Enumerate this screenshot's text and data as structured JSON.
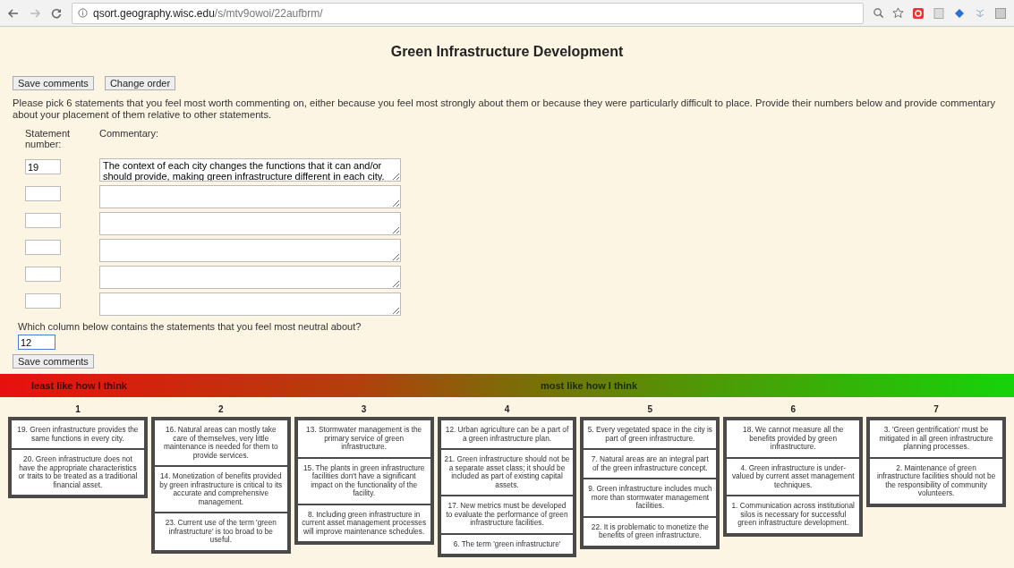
{
  "browser": {
    "url_host": "qsort.geography.wisc.edu",
    "url_path": "/s/mtv9owoi/22aufbrm/"
  },
  "title": "Green Infrastructure Development",
  "top_buttons": [
    "Save comments",
    "Change order"
  ],
  "instructions": "Please pick 6 statements that you feel most worth commenting on, either because you feel most strongly about them or because they were particularly difficult to place. Provide their numbers below and provide commentary about your placement of them relative to other statements.",
  "comments_table": {
    "number_header": "Statement number:",
    "commentary_header": "Commentary:",
    "rows": [
      {
        "number": "19",
        "commentary": "The context of each city changes the functions that it can and/or should provide, making green infrastructure different in each city."
      },
      {},
      {},
      {},
      {},
      {}
    ]
  },
  "neutral_question": {
    "label": "Which column below contains the statements that you feel most neutral about?",
    "value": "12"
  },
  "save_button": "Save comments",
  "scale_bar": {
    "least_label": "least like how I think",
    "most_label": "most like how I think"
  },
  "columns": [
    {
      "label": "1",
      "cards": [
        "19. Green infrastructure provides the same functions in every city.",
        "20. Green infrastructure does not have the appropriate characteristics or traits to be treated as a traditional financial asset."
      ]
    },
    {
      "label": "2",
      "cards": [
        "16. Natural areas can mostly take care of themselves, very little maintenance is needed for them to provide services.",
        "14. Monetization of benefits provided by green infrastructure is critical to its accurate and comprehensive management.",
        "23. Current use of the term 'green infrastructure' is too broad to be useful."
      ]
    },
    {
      "label": "3",
      "cards": [
        "13. Stormwater management is the primary service of green infrastructure.",
        "15. The plants in green infrastructure facilities don't have a significant impact on the functionality of the facility.",
        "8. Including green infrastructure in current asset management processes will improve maintenance schedules."
      ]
    },
    {
      "label": "4",
      "cards": [
        "12. Urban agriculture can be a part of a green infrastructure plan.",
        "21. Green infrastructure should not be a separate asset class; it should be included as part of existing capital assets.",
        "17. New metrics must be developed to evaluate the performance of green infrastructure facilities.",
        "6. The term 'green infrastructure'"
      ]
    },
    {
      "label": "5",
      "cards": [
        "5. Every vegetated space in the city is part of green infrastructure.",
        "7. Natural areas are an integral part of the green infrastructure concept.",
        "9. Green infrastructure includes much more than stormwater management facilities.",
        "22. It is problematic to monetize the benefits of green infrastructure."
      ]
    },
    {
      "label": "6",
      "cards": [
        "18. We cannot measure all the benefits provided by green infrastructure.",
        "4. Green infrastructure is under-valued by current asset management techniques.",
        "1. Communication across institutional silos is necessary for successful green infrastructure development."
      ]
    },
    {
      "label": "7",
      "cards": [
        "3. 'Green gentrification' must be mitigated in all green infrastructure planning processes.",
        "2. Maintenance of green infrastructure facilities should not be the responsibility of community volunteers."
      ]
    }
  ]
}
